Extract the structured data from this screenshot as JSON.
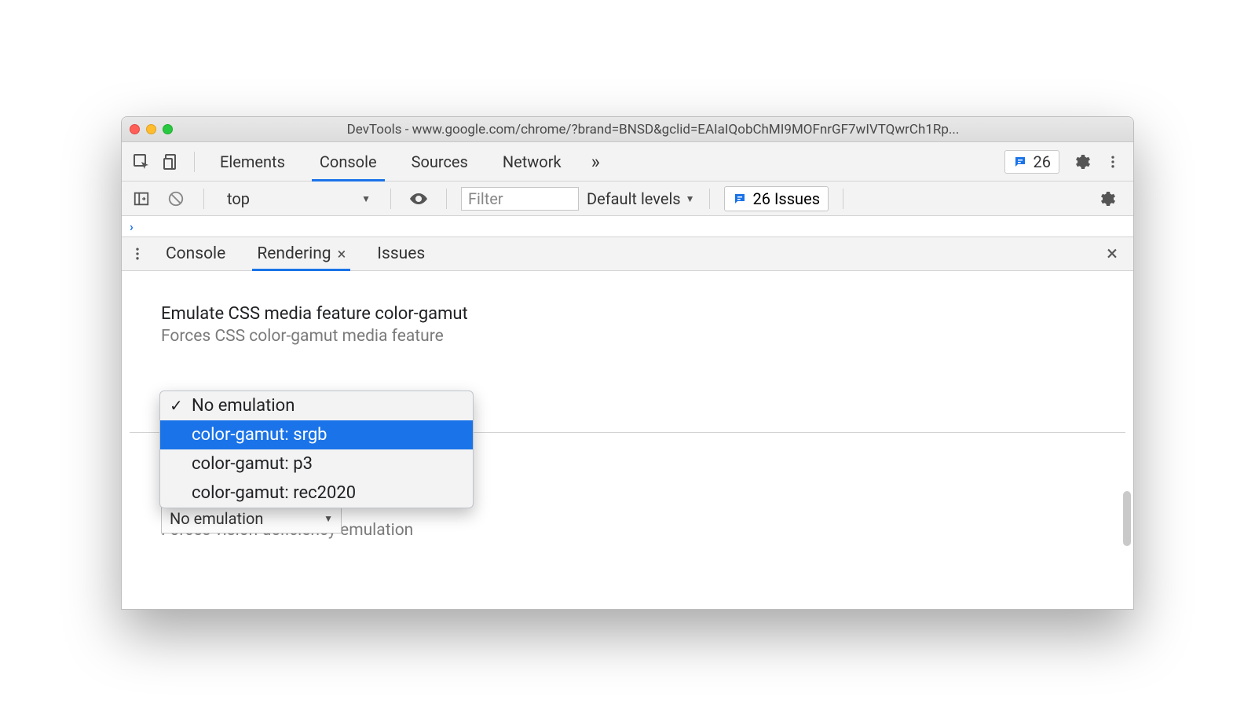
{
  "window": {
    "title": "DevTools - www.google.com/chrome/?brand=BNSD&gclid=EAIaIQobChMI9MOFnrGF7wIVTQwrCh1Rp..."
  },
  "main_tabs": {
    "items": [
      "Elements",
      "Console",
      "Sources",
      "Network"
    ],
    "active_index": 1,
    "overflow_glyph": "»",
    "issues_count": "26"
  },
  "console_toolbar": {
    "context": "top",
    "filter_placeholder": "Filter",
    "levels_label": "Default levels",
    "issues_label": "26 Issues"
  },
  "drawer_tabs": {
    "items": [
      "Console",
      "Rendering",
      "Issues"
    ],
    "active_index": 1
  },
  "rendering": {
    "section_heading": "Emulate CSS media feature color-gamut",
    "section_desc": "Forces CSS color-gamut media feature",
    "dropdown_options": [
      "No emulation",
      "color-gamut: srgb",
      "color-gamut: p3",
      "color-gamut: rec2020"
    ],
    "dropdown_checked_index": 0,
    "dropdown_highlight_index": 1,
    "obscured_partial_text": "Forces vision deficiency emulation",
    "lower_select_value": "No emulation"
  }
}
